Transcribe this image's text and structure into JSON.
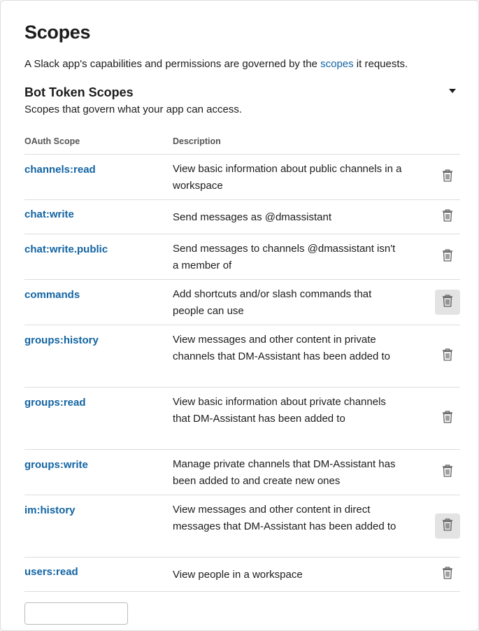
{
  "header": {
    "title": "Scopes",
    "intro_before": "A Slack app's capabilities and permissions are governed by the ",
    "intro_link": "scopes",
    "intro_after": " it requests."
  },
  "bot_section": {
    "title": "Bot Token Scopes",
    "subtitle": "Scopes that govern what your app can access.",
    "toggle_icon": "caret-down-icon"
  },
  "table": {
    "columns": [
      "OAuth Scope",
      "Description"
    ],
    "rows": [
      {
        "scope": "channels:read",
        "description": "View basic information about public channels in a workspace"
      },
      {
        "scope": "chat:write",
        "description": "Send messages as @dmassistant"
      },
      {
        "scope": "chat:write.public",
        "description": "Send messages to channels @dmassistant isn't a member of"
      },
      {
        "scope": "commands",
        "description": "Add shortcuts and/or slash commands that people can use"
      },
      {
        "scope": "groups:history",
        "description": "View messages and other content in private channels that DM-Assistant has been added to"
      },
      {
        "scope": "groups:read",
        "description": "View basic information about private channels that DM-Assistant has been added to"
      },
      {
        "scope": "groups:write",
        "description": "Manage private channels that DM-Assistant has been added to and create new ones"
      },
      {
        "scope": "im:history",
        "description": "View messages and other content in direct messages that DM-Assistant has been added to"
      },
      {
        "scope": "users:read",
        "description": "View people in a workspace"
      }
    ]
  },
  "colors": {
    "link": "#1264a3",
    "hover_bg": "#e3e3e3",
    "border": "#dddddd"
  }
}
